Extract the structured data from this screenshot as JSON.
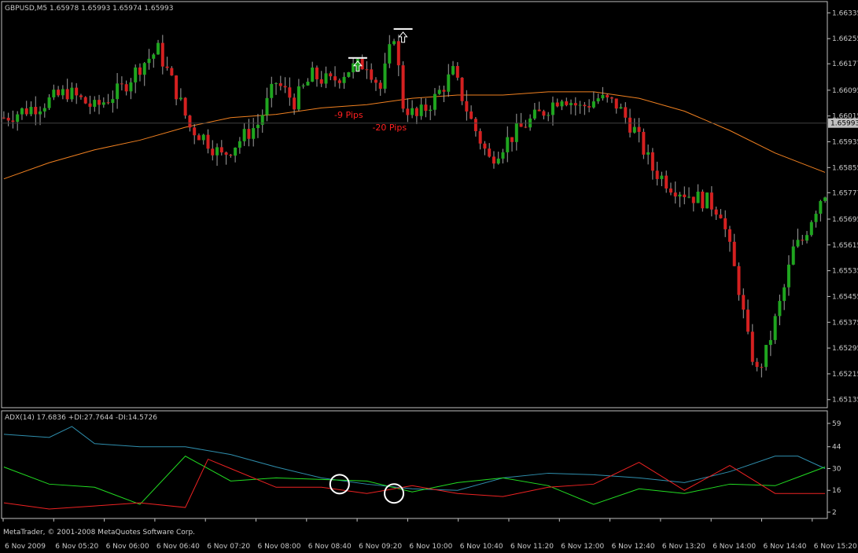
{
  "header": {
    "symbol_line": "GBPUSD,M5  1.65978 1.65993 1.65974 1.65993"
  },
  "indicator": {
    "label": "ADX(14) 17.6836 +DI:27.7644 -DI:14.5726",
    "axis_ticks": [
      "59",
      "44",
      "30",
      "16",
      "2"
    ]
  },
  "copyright": "MetaTrader, © 2001-2008 MetaQuotes Software Corp.",
  "annotations": [
    {
      "text": "-9 Pips",
      "color": "#ff2020",
      "price": 1.66044,
      "x_index": 76
    },
    {
      "text": "-20 Pips",
      "color": "#ff2020",
      "price": 1.66005,
      "x_index": 85
    }
  ],
  "colors": {
    "bull": "#1fa51f",
    "bear": "#d42020",
    "ma": "#f08020",
    "adx": "#2f8fae",
    "plus_di": "#22dd22",
    "minus_di": "#ee2222",
    "grid": "#505050",
    "label_box": "#c0c0c0"
  },
  "chart_data": {
    "type": "candlestick",
    "price_axis": {
      "ticks": [
        "1.66335",
        "1.66255",
        "1.66177",
        "1.66095",
        "1.66015",
        "1.65935",
        "1.65855",
        "1.65777",
        "1.65695",
        "1.65615",
        "1.65535",
        "1.65455",
        "1.65375",
        "1.65295",
        "1.65215",
        "1.65135"
      ],
      "current_price": "1.65993",
      "range": [
        1.6511,
        1.6637
      ]
    },
    "time_axis": {
      "labels": [
        "6 Nov 2009",
        "6 Nov 05:20",
        "6 Nov 06:00",
        "6 Nov 06:40",
        "6 Nov 07:20",
        "6 Nov 08:00",
        "6 Nov 08:40",
        "6 Nov 09:20",
        "6 Nov 10:00",
        "6 Nov 10:40",
        "6 Nov 11:20",
        "6 Nov 12:00",
        "6 Nov 12:40",
        "6 Nov 13:20",
        "6 Nov 14:00",
        "6 Nov 14:40",
        "6 Nov 15:20"
      ]
    },
    "close_path": [
      [
        0,
        1.6601
      ],
      [
        8,
        1.6605
      ],
      [
        14,
        1.6609
      ],
      [
        20,
        1.6604
      ],
      [
        26,
        1.661
      ],
      [
        30,
        1.6617
      ],
      [
        34,
        1.6622
      ],
      [
        38,
        1.6609
      ],
      [
        41,
        1.6598
      ],
      [
        44,
        1.6595
      ],
      [
        48,
        1.6589
      ],
      [
        52,
        1.6594
      ],
      [
        56,
        1.6599
      ],
      [
        60,
        1.6612
      ],
      [
        64,
        1.6606
      ],
      [
        68,
        1.6614
      ],
      [
        72,
        1.6612
      ],
      [
        76,
        1.6616
      ],
      [
        80,
        1.6618
      ],
      [
        83,
        1.661
      ],
      [
        86,
        1.6627
      ],
      [
        88,
        1.6605
      ],
      [
        91,
        1.6601
      ],
      [
        95,
        1.6607
      ],
      [
        99,
        1.6615
      ],
      [
        103,
        1.66
      ],
      [
        107,
        1.6588
      ],
      [
        111,
        1.6594
      ],
      [
        115,
        1.6599
      ],
      [
        119,
        1.6603
      ],
      [
        123,
        1.6608
      ],
      [
        127,
        1.6604
      ],
      [
        131,
        1.6607
      ],
      [
        135,
        1.6605
      ],
      [
        139,
        1.6597
      ],
      [
        143,
        1.6585
      ],
      [
        147,
        1.658
      ],
      [
        151,
        1.6577
      ],
      [
        155,
        1.6575
      ],
      [
        158,
        1.6572
      ],
      [
        160,
        1.656
      ],
      [
        162,
        1.6548
      ],
      [
        164,
        1.6532
      ],
      [
        166,
        1.6522
      ],
      [
        168,
        1.6528
      ],
      [
        170,
        1.6538
      ],
      [
        172,
        1.6548
      ],
      [
        174,
        1.656
      ],
      [
        176,
        1.6563
      ],
      [
        178,
        1.657
      ],
      [
        180,
        1.6576
      ],
      [
        181,
        1.6578
      ]
    ],
    "moving_average": [
      [
        0,
        1.6582
      ],
      [
        10,
        1.6587
      ],
      [
        20,
        1.6591
      ],
      [
        30,
        1.6594
      ],
      [
        40,
        1.6598
      ],
      [
        50,
        1.6601
      ],
      [
        60,
        1.6602
      ],
      [
        70,
        1.6604
      ],
      [
        80,
        1.6605
      ],
      [
        90,
        1.6607
      ],
      [
        100,
        1.6608
      ],
      [
        110,
        1.6608
      ],
      [
        120,
        1.6609
      ],
      [
        130,
        1.6609
      ],
      [
        140,
        1.6607
      ],
      [
        150,
        1.6603
      ],
      [
        160,
        1.6597
      ],
      [
        170,
        1.659
      ],
      [
        181,
        1.6584
      ]
    ],
    "adx_range": [
      2,
      59
    ],
    "adx": [
      [
        0,
        52
      ],
      [
        10,
        50
      ],
      [
        15,
        57
      ],
      [
        20,
        46
      ],
      [
        30,
        44
      ],
      [
        40,
        44
      ],
      [
        50,
        39
      ],
      [
        60,
        31
      ],
      [
        70,
        24
      ],
      [
        80,
        20
      ],
      [
        90,
        17
      ],
      [
        100,
        16
      ],
      [
        110,
        24
      ],
      [
        120,
        27
      ],
      [
        130,
        26
      ],
      [
        140,
        24
      ],
      [
        150,
        21
      ],
      [
        160,
        28
      ],
      [
        170,
        38
      ],
      [
        175,
        38
      ],
      [
        181,
        30
      ]
    ],
    "plus_di": [
      [
        0,
        31
      ],
      [
        10,
        20
      ],
      [
        20,
        18
      ],
      [
        30,
        7
      ],
      [
        40,
        38
      ],
      [
        50,
        22
      ],
      [
        60,
        24
      ],
      [
        70,
        23
      ],
      [
        80,
        22
      ],
      [
        90,
        15
      ],
      [
        100,
        21
      ],
      [
        110,
        24
      ],
      [
        120,
        19
      ],
      [
        130,
        7
      ],
      [
        140,
        17
      ],
      [
        150,
        14
      ],
      [
        160,
        20
      ],
      [
        170,
        19
      ],
      [
        181,
        31
      ]
    ],
    "minus_di": [
      [
        0,
        8
      ],
      [
        10,
        4
      ],
      [
        20,
        6
      ],
      [
        30,
        8
      ],
      [
        40,
        5
      ],
      [
        45,
        36
      ],
      [
        50,
        30
      ],
      [
        60,
        18
      ],
      [
        70,
        18
      ],
      [
        80,
        14
      ],
      [
        90,
        19
      ],
      [
        100,
        14
      ],
      [
        110,
        12
      ],
      [
        120,
        18
      ],
      [
        130,
        20
      ],
      [
        140,
        34
      ],
      [
        150,
        16
      ],
      [
        160,
        32
      ],
      [
        170,
        14
      ],
      [
        181,
        14
      ]
    ]
  }
}
